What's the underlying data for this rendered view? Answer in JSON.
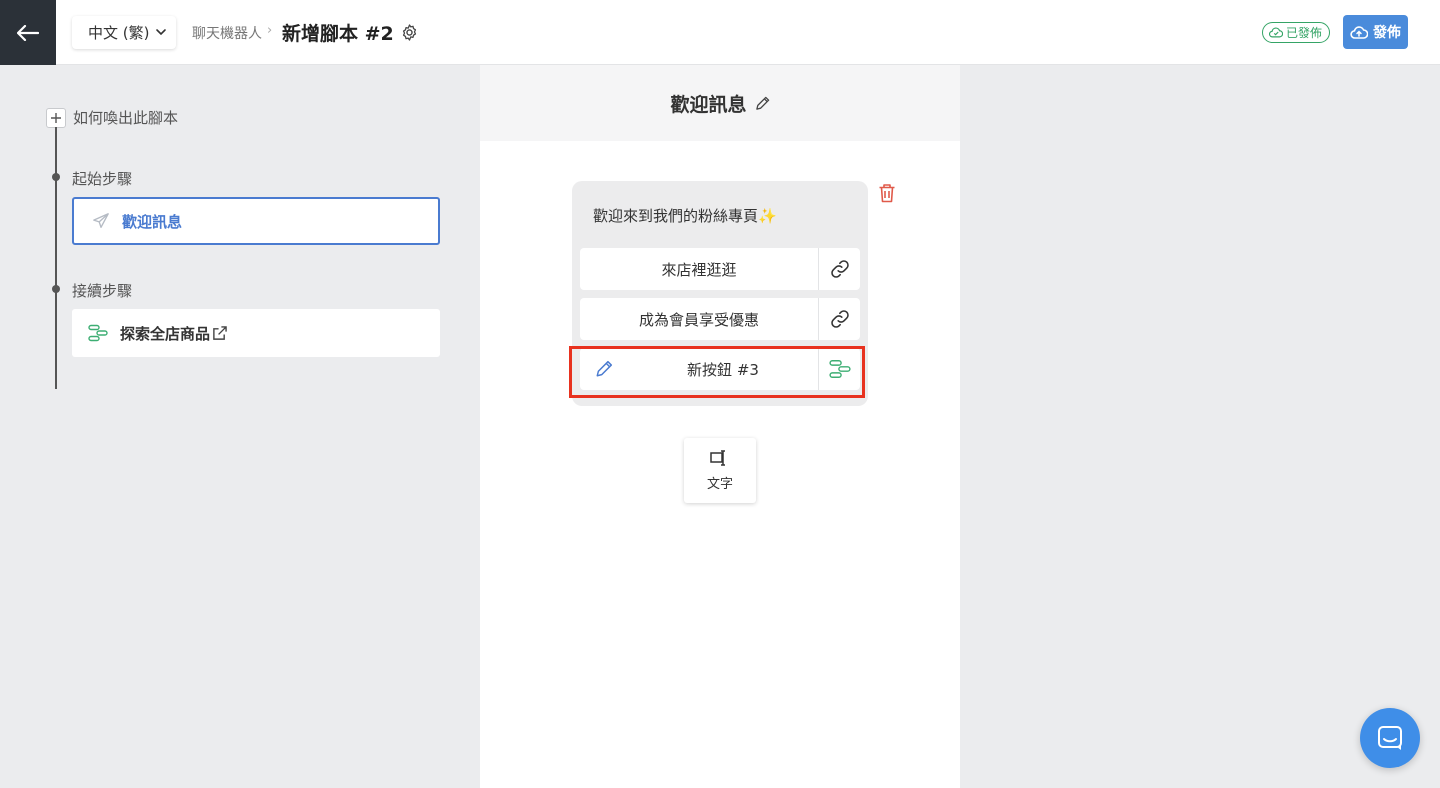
{
  "header": {
    "language": "中文 (繁)",
    "breadcrumb": "聊天機器人",
    "breadcrumb_sep": "›",
    "title": "新增腳本 #2",
    "status_badge": "已發佈",
    "publish_label": "發佈"
  },
  "sidebar": {
    "trigger_label": "如何喚出此腳本",
    "start_section": "起始步驟",
    "start_step": "歡迎訊息",
    "next_section": "接續步驟",
    "next_step": "探索全店商品"
  },
  "editor": {
    "title": "歡迎訊息",
    "message_text": "歡迎來到我們的粉絲專頁✨",
    "buttons": [
      {
        "label": "來店裡逛逛",
        "action_icon": "link-icon"
      },
      {
        "label": "成為會員享受優惠",
        "action_icon": "link-icon"
      },
      {
        "label": "新按鈕 #3",
        "action_icon": "flow-icon"
      }
    ],
    "add_text_label": "文字"
  },
  "colors": {
    "accent": "#4a7bd0",
    "publish": "#4a8bdb",
    "published": "#35a466",
    "flow_icon": "#3dae73",
    "delete": "#e05a4a",
    "highlight": "#e8321f"
  }
}
